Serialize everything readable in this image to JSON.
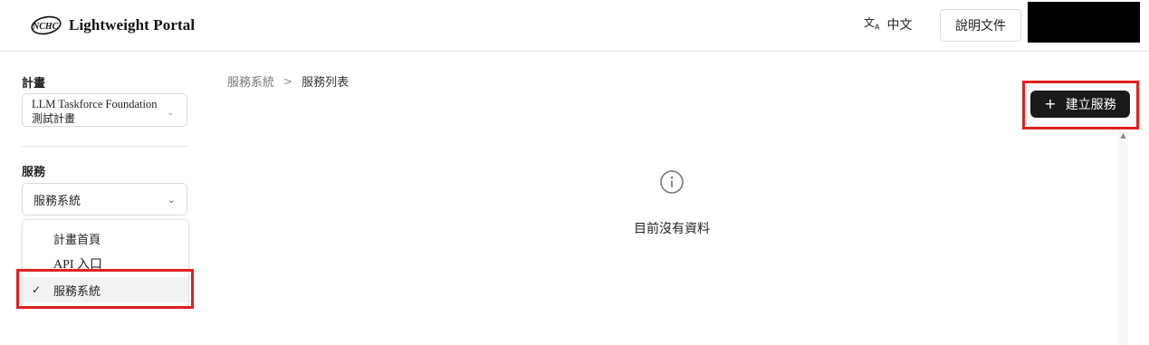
{
  "header": {
    "logo_text": "NCHC",
    "app_title": "Lightweight Portal",
    "lang_icon": "translate-icon",
    "lang_label": "中文",
    "docs_label": "說明文件"
  },
  "sidebar": {
    "project_label": "計畫",
    "project_value_line1": "LLM Taskforce Foundation",
    "project_value_line2": "測試計畫",
    "service_label": "服務",
    "service_value": "服務系統",
    "menu": [
      {
        "label": "計畫首頁",
        "selected": false
      },
      {
        "label": "API 入口",
        "selected": false
      },
      {
        "label": "服務系統",
        "selected": true
      }
    ]
  },
  "breadcrumb": {
    "parent": "服務系統",
    "separator": ">",
    "current": "服務列表"
  },
  "actions": {
    "create_plus": "+",
    "create_label": "建立服務"
  },
  "empty_state": {
    "icon": "info-icon",
    "message": "目前沒有資料"
  },
  "colors": {
    "highlight_box": "#e02020",
    "primary_button": "#1a1a1a"
  }
}
